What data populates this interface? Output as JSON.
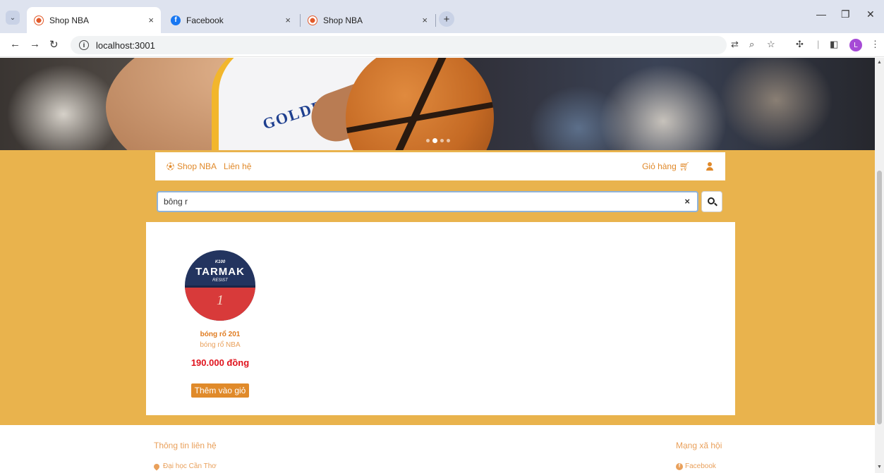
{
  "browser": {
    "tabs": [
      {
        "title": "Shop NBA",
        "favicon": "shop-favicon",
        "active": true
      },
      {
        "title": "Facebook",
        "favicon": "facebook-favicon",
        "active": false
      },
      {
        "title": "Shop NBA",
        "favicon": "shop-favicon",
        "active": false
      }
    ],
    "close_glyph": "×",
    "new_tab_glyph": "+",
    "url": "localhost:3001",
    "profile_initial": "L"
  },
  "navbar": {
    "brand": "Shop NBA",
    "contact": "Liên hệ",
    "cart": "Giỏ hàng"
  },
  "search": {
    "value": "bông r",
    "clear_glyph": "×"
  },
  "products": [
    {
      "image_brand": "TARMAK",
      "image_top": "K100",
      "image_sub": "RESIST",
      "image_number": "1",
      "name": "bóng rổ 201",
      "category": "bóng rổ NBA",
      "price": "190.000 đồng",
      "button": "Thêm vào giỏ"
    }
  ],
  "footer": {
    "contact_title": "Thông tin liên hệ",
    "address": "Đại học Cần Thơ",
    "social_title": "Mạng xã hội",
    "facebook": "Facebook"
  },
  "banner": {
    "jersey_text": "GOLDEN S",
    "slide_count": 4,
    "active_slide": 2
  },
  "colors": {
    "page_background": "#e9b34d",
    "accent": "#e0892a",
    "price": "#e0141e",
    "browser_frame": "#dee3ef"
  }
}
